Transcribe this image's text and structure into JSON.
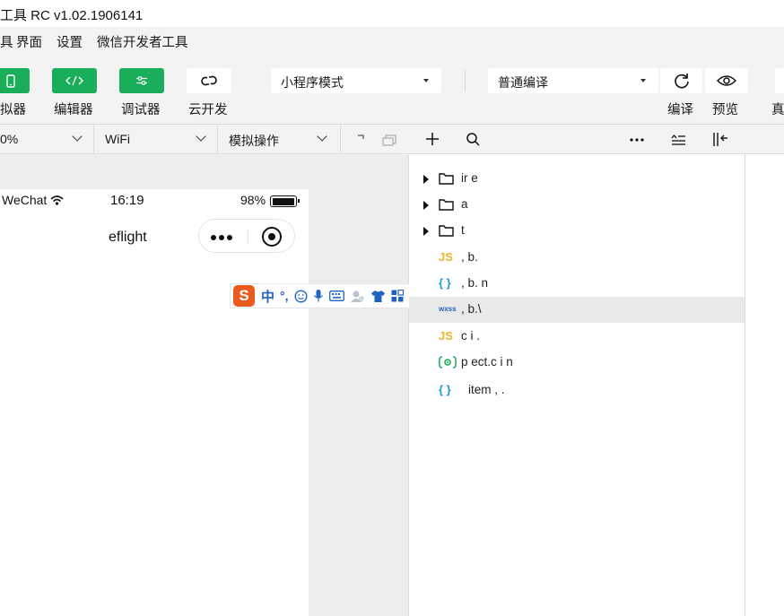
{
  "window": {
    "title": "工具 RC v1.02.1906141"
  },
  "menu": {
    "items": [
      "具",
      "界面",
      "设置",
      "微信开发者工具"
    ]
  },
  "toolbar": {
    "simulator_label": "拟器",
    "editor_label": "编辑器",
    "debugger_label": "调试器",
    "cloud_label": "云开发",
    "mode_select": "小程序模式",
    "compile_select": "普通编译",
    "compile_label": "编译",
    "preview_label": "预览",
    "real_label": "真",
    "accent_color": "#1aad5a"
  },
  "sim_bar": {
    "zoom": "0%",
    "network": "WiFi",
    "action": "模拟操作"
  },
  "phone": {
    "carrier": "WeChat",
    "time": "16:19",
    "battery": "98%",
    "battery_level": 0.98,
    "nav_title": "eflight"
  },
  "ime": {
    "logo": "S",
    "mode": "中",
    "punct": "°,"
  },
  "explorer": {
    "items": [
      {
        "type": "folder",
        "name": "ir    e"
      },
      {
        "type": "folder",
        "name": "  a"
      },
      {
        "type": "folder",
        "name": "t"
      },
      {
        "type": "js",
        "name": ",  b."
      },
      {
        "type": "json",
        "name": ",  b.    n"
      },
      {
        "type": "wxss",
        "name": ",  b.\\"
      },
      {
        "type": "js",
        "name": "c     i  ."
      },
      {
        "type": "config",
        "name": "p  ect.c       i       n"
      },
      {
        "type": "json",
        "name": "item  ,  ."
      }
    ],
    "type_labels": {
      "js": "JS",
      "json": "{ }",
      "wxss": "wxss"
    }
  }
}
